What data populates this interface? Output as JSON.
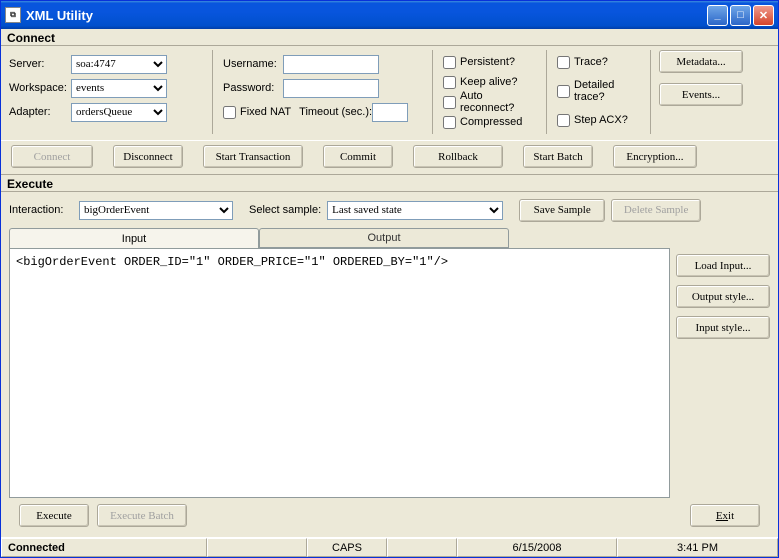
{
  "window": {
    "title": "XML Utility"
  },
  "connect": {
    "title": "Connect",
    "server_label": "Server:",
    "server_value": "soa:4747",
    "workspace_label": "Workspace:",
    "workspace_value": "events",
    "adapter_label": "Adapter:",
    "adapter_value": "ordersQueue",
    "username_label": "Username:",
    "username_value": "",
    "password_label": "Password:",
    "password_value": "",
    "fixed_nat_label": "Fixed NAT",
    "timeout_label": "Timeout (sec.):",
    "timeout_value": "",
    "persistent_label": "Persistent?",
    "keepalive_label": "Keep alive?",
    "autoreconnect_label": "Auto reconnect?",
    "compressed_label": "Compressed",
    "trace_label": "Trace?",
    "detailed_trace_label": "Detailed trace?",
    "step_acx_label": "Step ACX?",
    "metadata_btn": "Metadata...",
    "events_btn": "Events...",
    "connect_btn": "Connect",
    "disconnect_btn": "Disconnect",
    "start_tx_btn": "Start Transaction",
    "commit_btn": "Commit",
    "rollback_btn": "Rollback",
    "start_batch_btn": "Start Batch",
    "encryption_btn": "Encryption..."
  },
  "execute": {
    "title": "Execute",
    "interaction_label": "Interaction:",
    "interaction_value": "bigOrderEvent",
    "select_sample_label": "Select sample:",
    "select_sample_value": "Last saved state",
    "save_sample_btn": "Save Sample",
    "delete_sample_btn": "Delete Sample",
    "tab_input": "Input",
    "tab_output": "Output",
    "xml_content": "<bigOrderEvent ORDER_ID=\"1\" ORDER_PRICE=\"1\" ORDERED_BY=\"1\"/>",
    "load_input_btn": "Load Input...",
    "output_style_btn": "Output style...",
    "input_style_btn": "Input style...",
    "execute_btn": "Execute",
    "execute_batch_btn": "Execute Batch",
    "exit_btn": "Exit",
    "exit_btn_rest": "it"
  },
  "status": {
    "connected": "Connected",
    "caps": "CAPS",
    "date": "6/15/2008",
    "time": "3:41 PM"
  }
}
